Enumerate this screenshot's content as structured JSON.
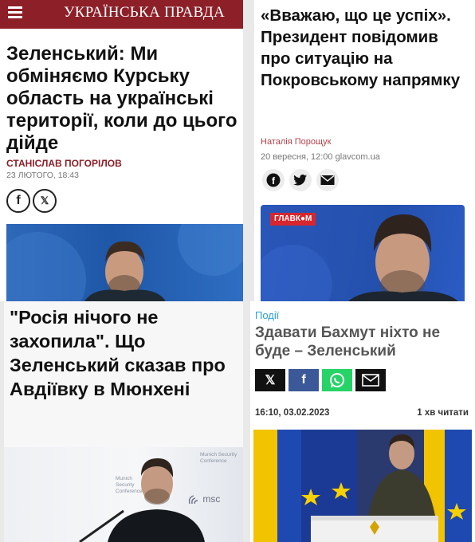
{
  "panel_up": {
    "site_logo": "УКРАЇНСЬКА ПРАВДА",
    "headline": "Зеленський: Ми обміняємо Курську область на українські території, коли до цього дійде",
    "author": "СТАНІСЛАВ ПОГОРІЛОВ",
    "date": "23 ЛЮТОГО, 18:43",
    "share": [
      "facebook",
      "x"
    ],
    "share_glyphs": {
      "facebook": "f",
      "x": "𝕏"
    }
  },
  "panel_glavcom": {
    "headline": "«Вважаю, що це успіх». Президент повідомив про ситуацію на Покровському напрямку",
    "author": "Наталія Порощук",
    "date_source": "20 вересня, 12:00 glavcom.ua",
    "share": [
      "facebook",
      "twitter",
      "email"
    ],
    "share_glyphs": {
      "facebook": "f",
      "twitter": "🐦",
      "email": "✉"
    },
    "photo_badge": "ГЛАВК●М"
  },
  "panel_munich": {
    "headline": "\"Росія нічого не захопила\". Що Зеленський сказав про Авдіївку в Мюнхені",
    "backdrop_texts": [
      "Munich Security Conference",
      "Munich Security Conference",
      "msc"
    ]
  },
  "panel_bakhmut": {
    "rubric": "Події",
    "headline": "Здавати Бахмут ніхто не буде – Зеленський",
    "share": [
      {
        "name": "x",
        "glyph": "𝕏",
        "color": "#111111"
      },
      {
        "name": "facebook",
        "glyph": "f",
        "color": "#3b5998"
      },
      {
        "name": "whatsapp",
        "glyph": "✆",
        "color": "#25d366"
      },
      {
        "name": "email",
        "glyph": "✉",
        "color": "#111111"
      }
    ],
    "datetime": "16:10, 03.02.2023",
    "read_time": "1 хв читати"
  },
  "colors": {
    "up_brand": "#8c1f27",
    "glavcom_author": "#b5424b",
    "rubric": "#2e9fd9"
  }
}
